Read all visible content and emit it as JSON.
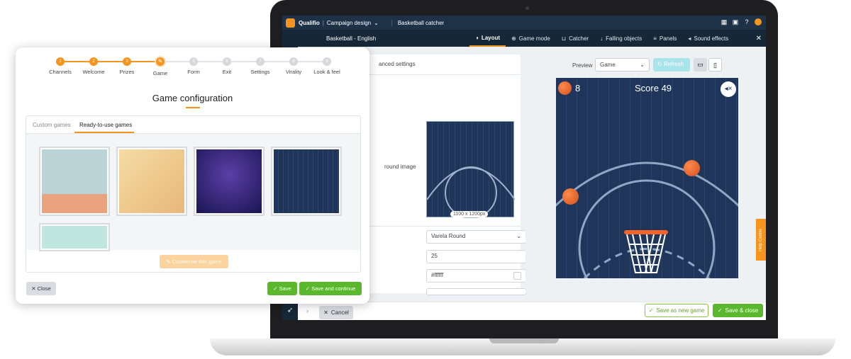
{
  "app": {
    "brand": "Qualifio",
    "section": "Campaign design",
    "campaign_tab": "Basketball catcher",
    "title": "Basketball - English"
  },
  "editor_tabs": [
    {
      "label": "Layout",
      "icon": "palette-icon",
      "active": true
    },
    {
      "label": "Game mode",
      "icon": "gamepad-icon",
      "active": false
    },
    {
      "label": "Catcher",
      "icon": "basket-icon",
      "active": false
    },
    {
      "label": "Falling objects",
      "icon": "falling-icon",
      "active": false
    },
    {
      "label": "Panels",
      "icon": "panels-icon",
      "active": false
    },
    {
      "label": "Sound effects",
      "icon": "speaker-icon",
      "active": false
    }
  ],
  "settings": {
    "advanced_tab": "anced settings",
    "bg_label": "round image",
    "bg_dimensions": "1100 x 1200px",
    "font": "Varela Round",
    "font_size": "25",
    "color": "#ffffff"
  },
  "preview": {
    "label": "Preview",
    "mode": "Game",
    "refresh_label": "Refresh",
    "ball_count": "8",
    "score": "Score 49"
  },
  "help": {
    "label": "Help Centre"
  },
  "footer": {
    "cancel": "Cancel",
    "save_new": "Save as new game",
    "save_close": "Save & close"
  },
  "modal": {
    "steps": [
      {
        "num": "1",
        "label": "Channels",
        "state": "done"
      },
      {
        "num": "2",
        "label": "Welcome",
        "state": "done"
      },
      {
        "num": "3",
        "label": "Prizes",
        "state": "done"
      },
      {
        "num": "✎",
        "label": "Game",
        "state": "current"
      },
      {
        "num": "5",
        "label": "Form",
        "state": "todo"
      },
      {
        "num": "6",
        "label": "Exit",
        "state": "todo"
      },
      {
        "num": "7",
        "label": "Settings",
        "state": "todo"
      },
      {
        "num": "8",
        "label": "Virality",
        "state": "todo"
      },
      {
        "num": "9",
        "label": "Look & feel",
        "state": "todo"
      }
    ],
    "title": "Game configuration",
    "tab_custom": "Custom games",
    "tab_ready": "Ready-to-use games",
    "customise": "Customise this game",
    "close": "Close",
    "save": "Save",
    "save_continue": "Save and continue"
  },
  "colors": {
    "accent": "#f7941d",
    "green": "#5bb82e",
    "navy": "#1d3247"
  }
}
